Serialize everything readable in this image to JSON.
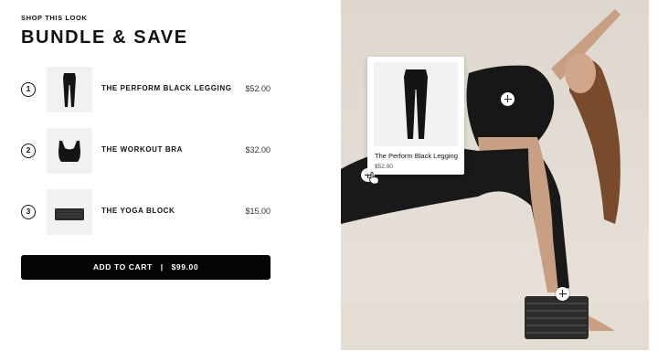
{
  "header": {
    "eyebrow": "SHOP THIS LOOK",
    "title": "BUNDLE & SAVE"
  },
  "items": [
    {
      "number": "1",
      "name": "THE PERFORM BLACK LEGGING",
      "price": "$52.00",
      "icon": "legging-icon"
    },
    {
      "number": "2",
      "name": "THE WORKOUT BRA",
      "price": "$32.00",
      "icon": "sports-bra-icon"
    },
    {
      "number": "3",
      "name": "THE YOGA BLOCK",
      "price": "$15.00",
      "icon": "yoga-block-icon"
    }
  ],
  "cart": {
    "label": "ADD TO CART",
    "separator": "|",
    "total": "$99.00"
  },
  "popup": {
    "name": "The Perform Black Legging",
    "price": "$52.00"
  },
  "colors": {
    "button": "#050505",
    "text": "#111111",
    "thumb_bg": "#f1f1f1",
    "photo_bg": "#ddd7ce"
  }
}
